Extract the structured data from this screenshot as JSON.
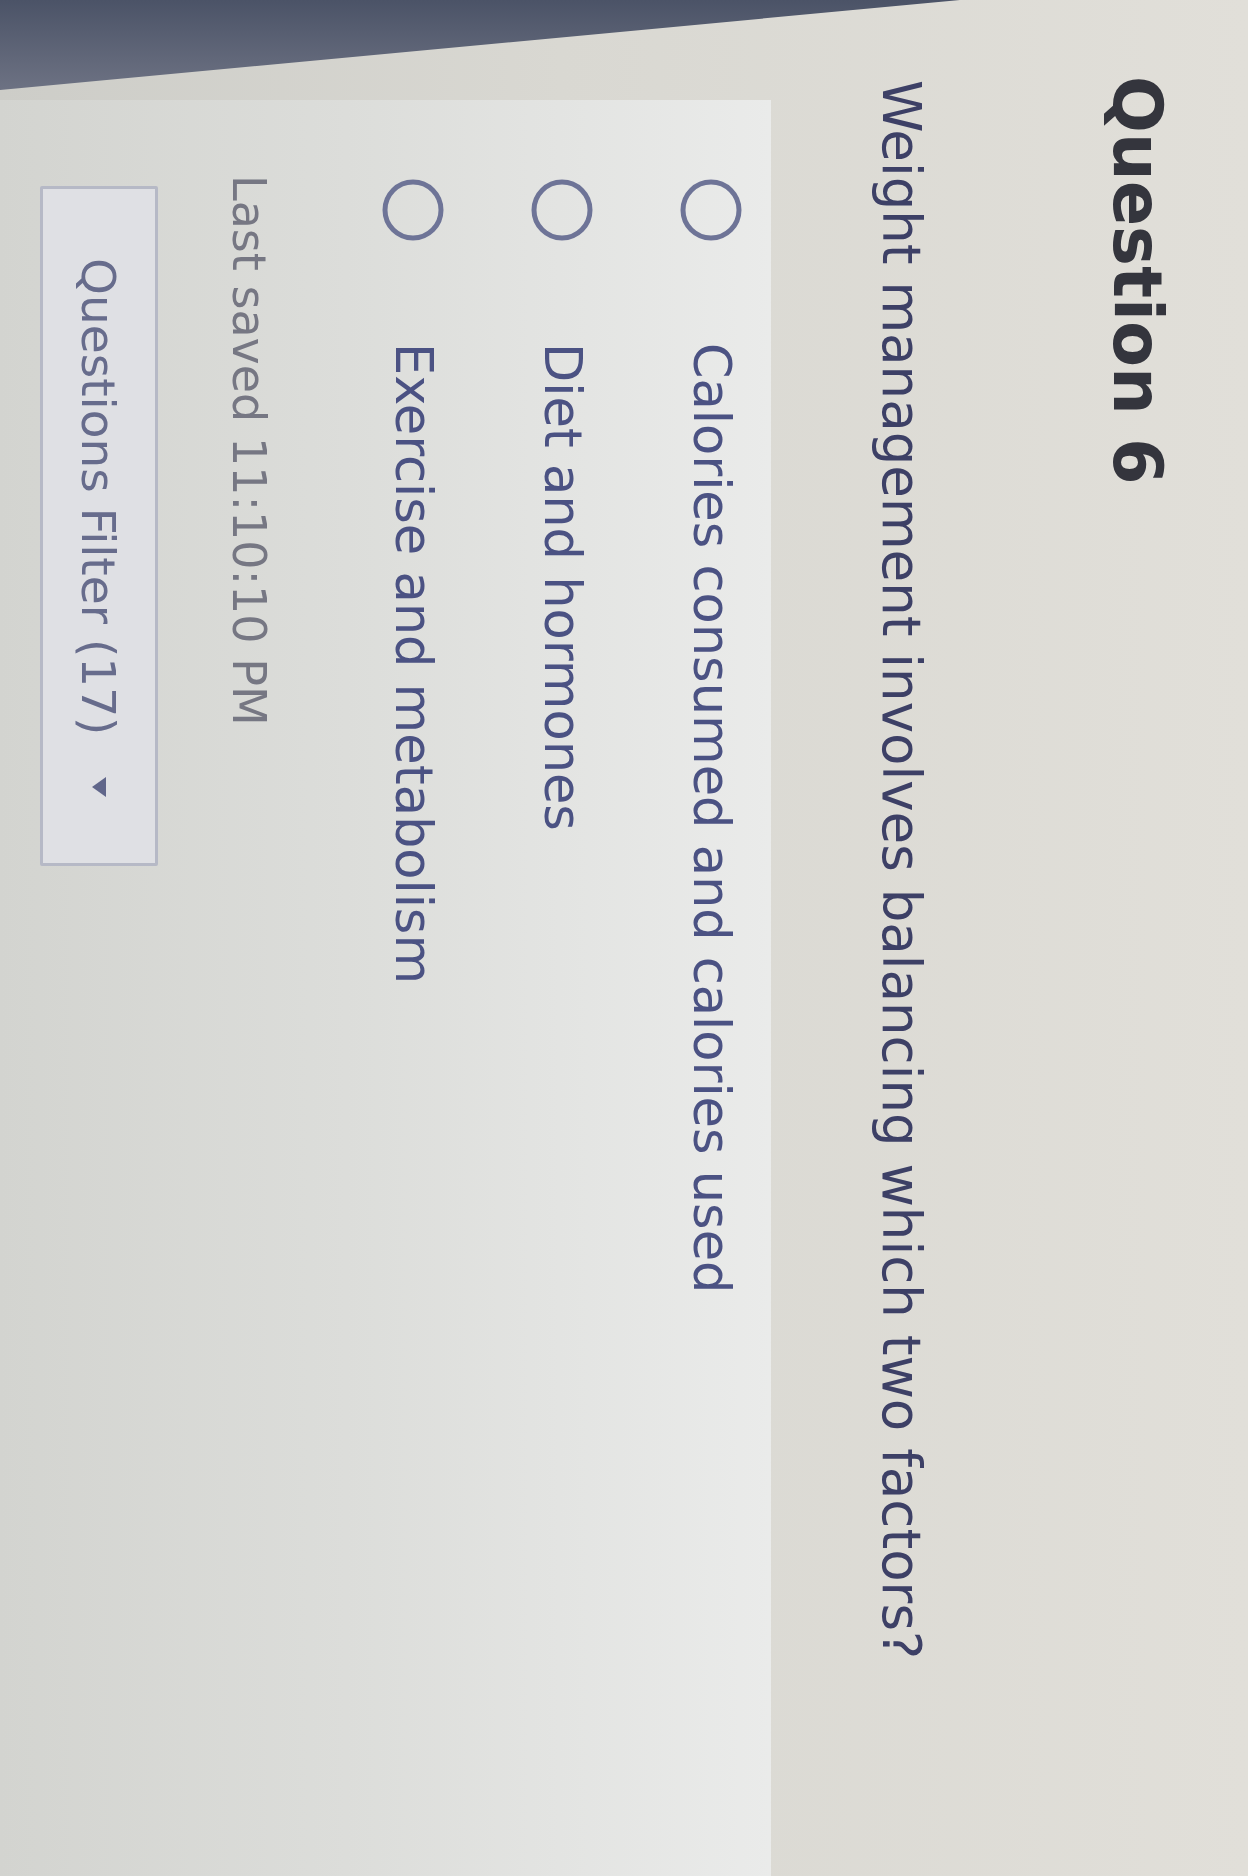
{
  "question": {
    "heading": "Question 6",
    "text": "Weight management involves balancing which two factors?"
  },
  "options": [
    {
      "label": "Calories consumed and calories used",
      "selected": false
    },
    {
      "label": "Diet and hormones",
      "selected": false
    },
    {
      "label": "Exercise and metabolism",
      "selected": false
    }
  ],
  "last_saved": "Last saved 11:10:10 PM",
  "filter_button": {
    "label": "Questions Filter (17)"
  }
}
